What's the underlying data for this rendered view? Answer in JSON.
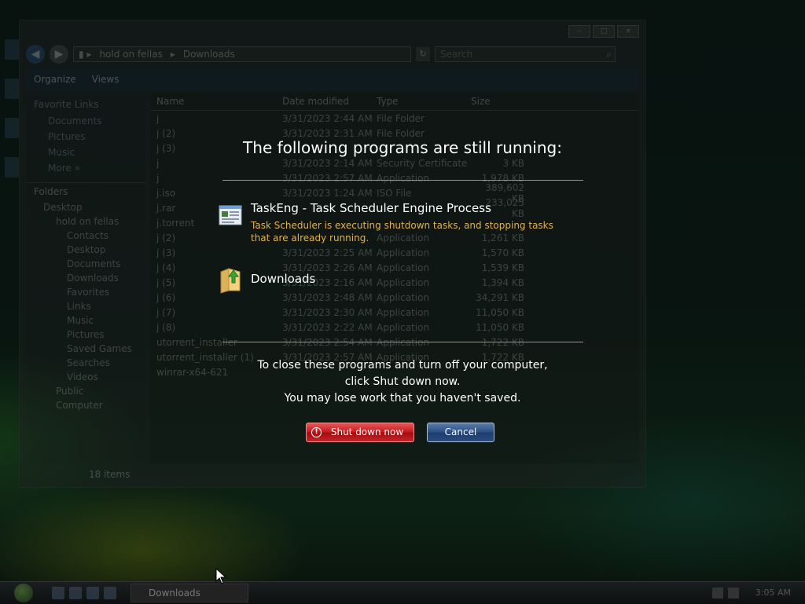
{
  "explorer": {
    "address": [
      "hold on fellas",
      "Downloads"
    ],
    "search_placeholder": "Search",
    "toolbar": {
      "organize": "Organize",
      "views": "Views"
    },
    "favorite_links_title": "Favorite Links",
    "favorites": [
      "Documents",
      "Pictures",
      "Music",
      "More »"
    ],
    "folders_title": "Folders",
    "tree": [
      "Desktop",
      "hold on fellas",
      "Contacts",
      "Desktop",
      "Documents",
      "Downloads",
      "Favorites",
      "Links",
      "Music",
      "Pictures",
      "Saved Games",
      "Searches",
      "Videos",
      "Public",
      "Computer"
    ],
    "columns": [
      "Name",
      "Date modified",
      "Type",
      "Size"
    ],
    "files": [
      {
        "name": "j",
        "date": "3/31/2023 2:44 AM",
        "type": "File Folder",
        "size": ""
      },
      {
        "name": "j (2)",
        "date": "3/31/2023 2:31 AM",
        "type": "File Folder",
        "size": ""
      },
      {
        "name": "j (3)",
        "date": "",
        "type": "",
        "size": ""
      },
      {
        "name": "j",
        "date": "3/31/2023 2:14 AM",
        "type": "Security Certificate",
        "size": "3 KB"
      },
      {
        "name": "j",
        "date": "3/31/2023 2:57 AM",
        "type": "Application",
        "size": "1,978 KB"
      },
      {
        "name": "j.iso",
        "date": "3/31/2023 1:24 AM",
        "type": "ISO File",
        "size": "389,602 KB"
      },
      {
        "name": "j.rar",
        "date": "",
        "type": "",
        "size": "233,025 KB"
      },
      {
        "name": "j.torrent",
        "date": "",
        "type": "",
        "size": ""
      },
      {
        "name": "j (2)",
        "date": "",
        "type": "Application",
        "size": "1,261 KB"
      },
      {
        "name": "j (3)",
        "date": "3/31/2023 2:25 AM",
        "type": "Application",
        "size": "1,570 KB"
      },
      {
        "name": "j (4)",
        "date": "3/31/2023 2:26 AM",
        "type": "Application",
        "size": "1,539 KB"
      },
      {
        "name": "j (5)",
        "date": "3/31/2023 2:16 AM",
        "type": "Application",
        "size": "1,394 KB"
      },
      {
        "name": "j (6)",
        "date": "3/31/2023 2:48 AM",
        "type": "Application",
        "size": "34,291 KB"
      },
      {
        "name": "j (7)",
        "date": "3/31/2023 2:30 AM",
        "type": "Application",
        "size": "11,050 KB"
      },
      {
        "name": "j (8)",
        "date": "3/31/2023 2:22 AM",
        "type": "Application",
        "size": "11,050 KB"
      },
      {
        "name": "utorrent_installer",
        "date": "3/31/2023 2:54 AM",
        "type": "Application",
        "size": "1,722 KB"
      },
      {
        "name": "utorrent_installer (1)",
        "date": "3/31/2023 2:57 AM",
        "type": "Application",
        "size": "1,722 KB"
      },
      {
        "name": "winrar-x64-621",
        "date": "",
        "type": "",
        "size": ""
      }
    ],
    "item_count": "18 items"
  },
  "dialog": {
    "heading": "The following programs are still running:",
    "programs": [
      {
        "icon": "taskeng-window-icon",
        "title": "TaskEng - Task Scheduler Engine Process",
        "description": "Task Scheduler is executing shutdown tasks, and stopping tasks that are already running."
      },
      {
        "icon": "downloads-folder-icon",
        "title": "Downloads",
        "description": ""
      }
    ],
    "message_lines": [
      "To close these programs and turn off your computer,",
      "click Shut down now.",
      "You may lose work that you haven't saved."
    ],
    "shutdown_button": "Shut down now",
    "cancel_button": "Cancel"
  },
  "taskbar": {
    "active_window": "Downloads",
    "clock": "3:05 AM"
  },
  "colors": {
    "warning_text": "#e1b24f",
    "shutdown_red": "#c41a1c",
    "cancel_blue": "#2c4f84"
  }
}
